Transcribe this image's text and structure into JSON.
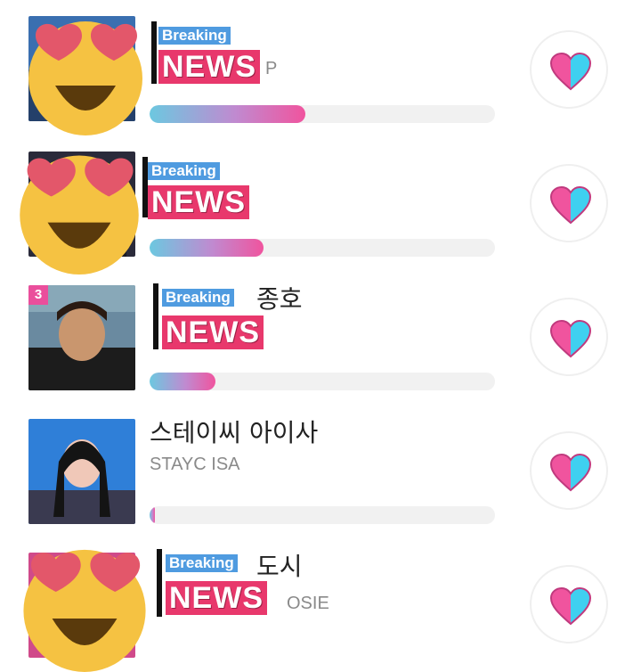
{
  "rows": [
    {
      "rank": "",
      "title": "",
      "subtitle": "P",
      "progress": 0.45
    },
    {
      "rank": "",
      "title": "",
      "subtitle": "",
      "progress": 0.33
    },
    {
      "rank": "3",
      "title": "종호",
      "subtitle": "",
      "progress": 0.19
    },
    {
      "rank": "",
      "title": "스테이씨 아이사",
      "subtitle": "STAYC ISA",
      "progress": 0.015
    },
    {
      "rank": "",
      "title": "도시",
      "subtitle": "OSIE",
      "progress": 0.0
    }
  ],
  "overlay": {
    "breaking": "Breaking",
    "news": "NEWS"
  },
  "colors": {
    "accent_pink": "#ea4f9c",
    "heart_pink": "#f0549e",
    "heart_cyan": "#3fd0f0",
    "bar_track": "#f1f1f1"
  },
  "icons": {
    "vote": "heart-icon",
    "sticker": "heart-eyes-emoji"
  }
}
